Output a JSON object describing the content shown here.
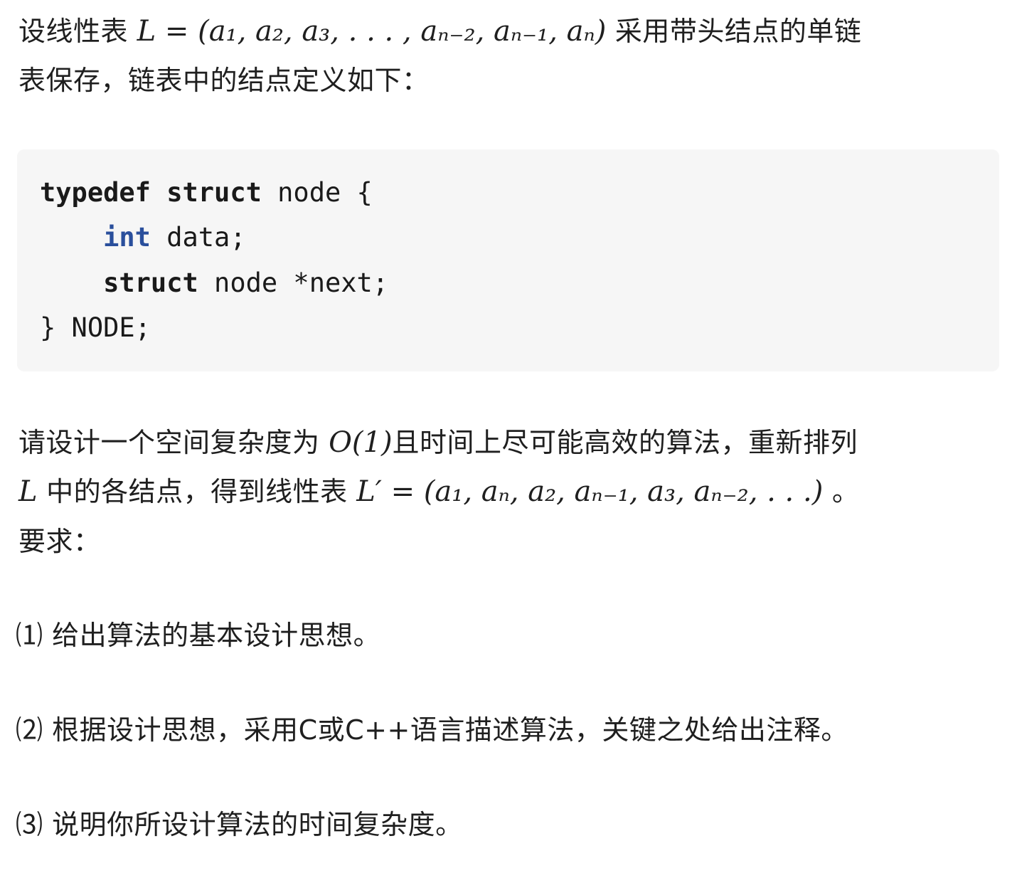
{
  "intro": {
    "line1_prefix": "设线性表 ",
    "line1_math": "L = (a₁, a₂, a₃, . . . , aₙ₋₂, aₙ₋₁, aₙ)",
    "line1_suffix": " 采用带头结点的单链",
    "line2": "表保存，链表中的结点定义如下："
  },
  "code": {
    "line1_kw": "typedef",
    "line1_kw2": "struct",
    "line1_rest": " node {",
    "line2_indent": "    ",
    "line2_type": "int",
    "line2_rest": " data;",
    "line3_indent": "    ",
    "line3_kw": "struct",
    "line3_rest": " node *next;",
    "line4": "} NODE;"
  },
  "task": {
    "line1_prefix": "请设计一个空间复杂度为 ",
    "line1_math": "O(1)",
    "line1_suffix": "且时间上尽可能高效的算法，重新排列",
    "line2_math_a": "L",
    "line2_text": " 中的各结点，得到线性表 ",
    "line2_math_b": "L′ = (a₁, aₙ, a₂, aₙ₋₁, a₃, aₙ₋₂, . . .)",
    "line2_suffix": " 。",
    "line3": "要求："
  },
  "requirements": [
    "⑴ 给出算法的基本设计思想。",
    "⑵ 根据设计思想，采用C或C++语言描述算法，关键之处给出注释。",
    "⑶ 说明你所设计算法的时间复杂度。"
  ]
}
